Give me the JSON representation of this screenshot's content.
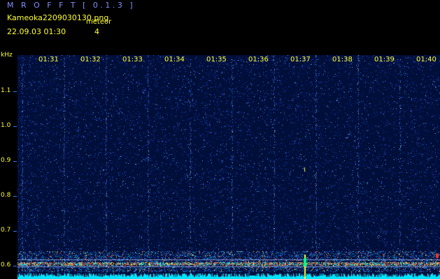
{
  "header": {
    "app_title": "M R O F F T [ 0.1.3 ]",
    "file_name": "Kameoka2209030130.png",
    "meteor_label": "meteor",
    "timestamp": "22.09.03 01:30",
    "meteor_count": "4"
  },
  "axes": {
    "y_unit": "kHz",
    "y_ticks": [
      "1.1",
      "1.0",
      "0.9",
      "0.8",
      "0.7",
      "0.6"
    ],
    "x_ticks": [
      "01:31",
      "01:32",
      "01:33",
      "01:34",
      "01:35",
      "01:36",
      "01:37",
      "01:38",
      "01:39",
      "01:40"
    ]
  },
  "colors": {
    "background": "#000000",
    "label_yellow": "#ffff33",
    "title_blue": "#7f8fff",
    "noise_base": "#000e3a",
    "carrier_cyan": "#00e5ff"
  }
}
